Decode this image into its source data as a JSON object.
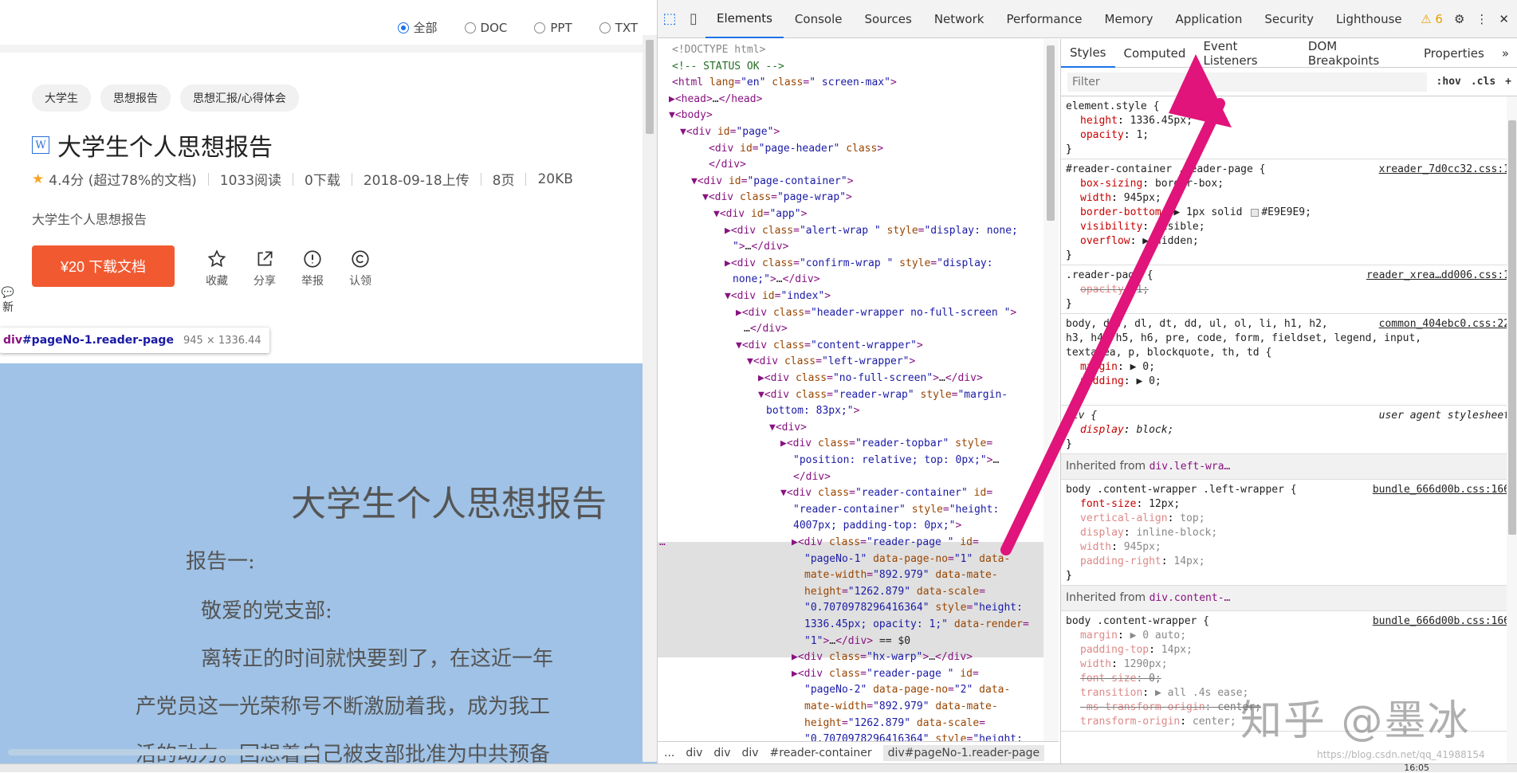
{
  "page": {
    "filters": [
      {
        "label": "全部",
        "checked": true
      },
      {
        "label": "DOC",
        "checked": false
      },
      {
        "label": "PPT",
        "checked": false
      },
      {
        "label": "TXT",
        "checked": false
      }
    ],
    "tags": [
      "大学生",
      "思想报告",
      "思想汇报/心得体会"
    ],
    "doc_icon": "W",
    "title": "大学生个人思想报告",
    "rating": "4.4分 (超过78%的文档)",
    "reads": "1033阅读",
    "downloads": "0下载",
    "upload": "2018-09-18上传",
    "pages": "8页",
    "size": "20KB",
    "description": "大学生个人思想报告",
    "download_button": "¥20 下载文档",
    "actions": [
      "收藏",
      "分享",
      "举报",
      "认领"
    ],
    "side_float": "新"
  },
  "tooltip": {
    "tag": "div",
    "selector": "#pageNo-1.reader-page",
    "dimensions": "945 × 1336.44"
  },
  "doc_page": {
    "title": "大学生个人思想报告",
    "lines": [
      "报告一:",
      "敬爱的党支部:",
      "离转正的时间就快要到了，在这近一年",
      "产党员这一光荣称号不断激励着我，成为我工",
      "活的动力。回想着自己被支部批准为中共预备"
    ]
  },
  "devtools": {
    "tabs": [
      "Elements",
      "Console",
      "Sources",
      "Network",
      "Performance",
      "Memory",
      "Application",
      "Security",
      "Lighthouse"
    ],
    "active_tab": "Elements",
    "warnings": "6",
    "breadcrumbs": [
      "...",
      "div",
      "div",
      "div",
      "#reader-container",
      "div#pageNo-1.reader-page"
    ],
    "styles_tabs": [
      "Styles",
      "Computed",
      "Event Listeners",
      "DOM Breakpoints",
      "Properties",
      "»"
    ],
    "filter_placeholder": "Filter",
    "hov": ":hov",
    "cls": ".cls",
    "plus": "+",
    "inherited_1": "Inherited from",
    "inherited_1_el": "div.left-wra…",
    "inherited_2": "Inherited from",
    "inherited_2_el": "div.content-…"
  },
  "watermark": {
    "text": "知乎 @墨冰",
    "url": "https://blog.csdn.net/qq_41988154"
  },
  "taskbar": {
    "time": "16:05"
  },
  "colors": {
    "accent": "#1a73e8",
    "download": "#f15a31",
    "highlight": "#9fc2e6",
    "arrow": "#e0147a"
  }
}
